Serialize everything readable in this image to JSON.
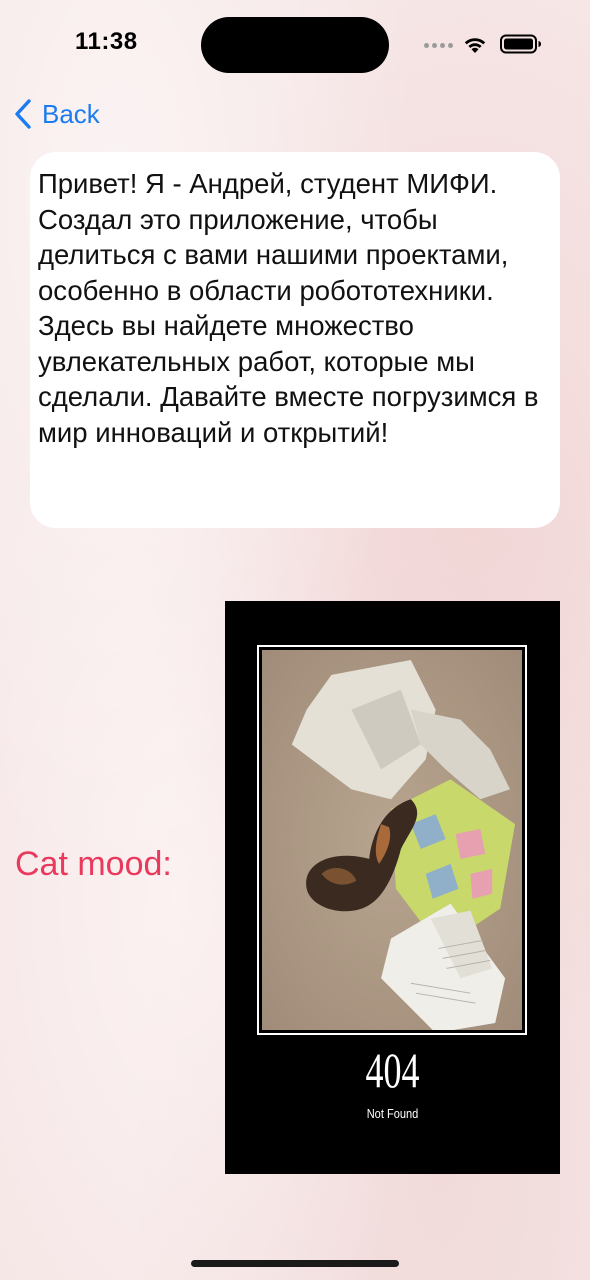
{
  "status_bar": {
    "time": "11:38",
    "wifi_icon": "wifi-icon",
    "battery_icon": "battery-icon"
  },
  "nav": {
    "back_label": "Back",
    "back_icon": "chevron-left-icon"
  },
  "intro": {
    "text": "Привет! Я - Андрей, студент МИФИ. Создал это приложение, чтобы делиться с вами нашими проектами, особенно в области робототехники. Здесь вы найдете множество увлекательных работ, которые мы сделали. Давайте вместе погрузимся в мир инноваций и открытий!"
  },
  "cat_mood": {
    "label": "Cat mood:",
    "poster_title": "404",
    "poster_caption": "Not Found"
  },
  "colors": {
    "accent_blue": "#1a7cf0",
    "cat_mood_red": "#e9395c",
    "background_pink": "#f6e6e6"
  }
}
